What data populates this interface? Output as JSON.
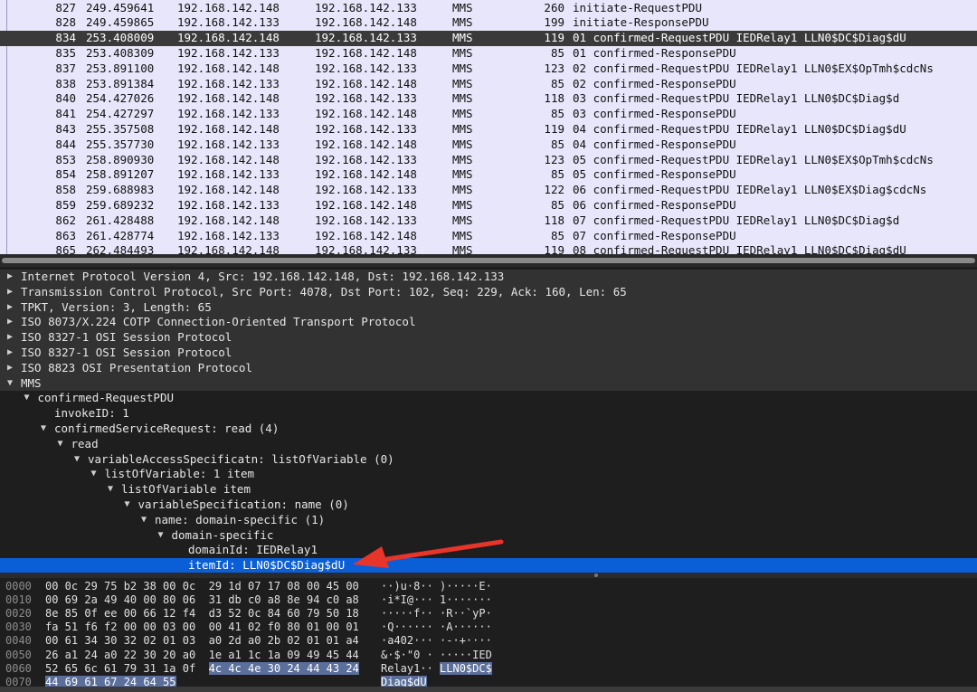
{
  "packets": [
    {
      "no": "827",
      "time": "249.459641",
      "src": "192.168.142.148",
      "dst": "192.168.142.133",
      "proto": "MMS",
      "len": "260",
      "info": "initiate-RequestPDU",
      "selected": false
    },
    {
      "no": "828",
      "time": "249.459865",
      "src": "192.168.142.133",
      "dst": "192.168.142.148",
      "proto": "MMS",
      "len": "199",
      "info": "initiate-ResponsePDU",
      "selected": false
    },
    {
      "no": "834",
      "time": "253.408009",
      "src": "192.168.142.148",
      "dst": "192.168.142.133",
      "proto": "MMS",
      "len": "119",
      "info": "01 confirmed-RequestPDU IEDRelay1 LLN0$DC$Diag$dU",
      "selected": true
    },
    {
      "no": "835",
      "time": "253.408309",
      "src": "192.168.142.133",
      "dst": "192.168.142.148",
      "proto": "MMS",
      "len": "85",
      "info": "01 confirmed-ResponsePDU",
      "selected": false
    },
    {
      "no": "837",
      "time": "253.891100",
      "src": "192.168.142.148",
      "dst": "192.168.142.133",
      "proto": "MMS",
      "len": "123",
      "info": "02 confirmed-RequestPDU IEDRelay1 LLN0$EX$OpTmh$cdcNs",
      "selected": false
    },
    {
      "no": "838",
      "time": "253.891384",
      "src": "192.168.142.133",
      "dst": "192.168.142.148",
      "proto": "MMS",
      "len": "85",
      "info": "02 confirmed-ResponsePDU",
      "selected": false
    },
    {
      "no": "840",
      "time": "254.427026",
      "src": "192.168.142.148",
      "dst": "192.168.142.133",
      "proto": "MMS",
      "len": "118",
      "info": "03 confirmed-RequestPDU IEDRelay1 LLN0$DC$Diag$d",
      "selected": false
    },
    {
      "no": "841",
      "time": "254.427297",
      "src": "192.168.142.133",
      "dst": "192.168.142.148",
      "proto": "MMS",
      "len": "85",
      "info": "03 confirmed-ResponsePDU",
      "selected": false
    },
    {
      "no": "843",
      "time": "255.357508",
      "src": "192.168.142.148",
      "dst": "192.168.142.133",
      "proto": "MMS",
      "len": "119",
      "info": "04 confirmed-RequestPDU IEDRelay1 LLN0$DC$Diag$dU",
      "selected": false
    },
    {
      "no": "844",
      "time": "255.357730",
      "src": "192.168.142.133",
      "dst": "192.168.142.148",
      "proto": "MMS",
      "len": "85",
      "info": "04 confirmed-ResponsePDU",
      "selected": false
    },
    {
      "no": "853",
      "time": "258.890930",
      "src": "192.168.142.148",
      "dst": "192.168.142.133",
      "proto": "MMS",
      "len": "123",
      "info": "05 confirmed-RequestPDU IEDRelay1 LLN0$EX$OpTmh$cdcNs",
      "selected": false
    },
    {
      "no": "854",
      "time": "258.891207",
      "src": "192.168.142.133",
      "dst": "192.168.142.148",
      "proto": "MMS",
      "len": "85",
      "info": "05 confirmed-ResponsePDU",
      "selected": false
    },
    {
      "no": "858",
      "time": "259.688983",
      "src": "192.168.142.148",
      "dst": "192.168.142.133",
      "proto": "MMS",
      "len": "122",
      "info": "06 confirmed-RequestPDU IEDRelay1 LLN0$EX$Diag$cdcNs",
      "selected": false
    },
    {
      "no": "859",
      "time": "259.689232",
      "src": "192.168.142.133",
      "dst": "192.168.142.148",
      "proto": "MMS",
      "len": "85",
      "info": "06 confirmed-ResponsePDU",
      "selected": false
    },
    {
      "no": "862",
      "time": "261.428488",
      "src": "192.168.142.148",
      "dst": "192.168.142.133",
      "proto": "MMS",
      "len": "118",
      "info": "07 confirmed-RequestPDU IEDRelay1 LLN0$DC$Diag$d",
      "selected": false
    },
    {
      "no": "863",
      "time": "261.428774",
      "src": "192.168.142.133",
      "dst": "192.168.142.148",
      "proto": "MMS",
      "len": "85",
      "info": "07 confirmed-ResponsePDU",
      "selected": false
    },
    {
      "no": "865",
      "time": "262.484493",
      "src": "192.168.142.148",
      "dst": "192.168.142.133",
      "proto": "MMS",
      "len": "119",
      "info": "08 confirmed-RequestPDU IEDRelay1 LLN0$DC$Diag$dU",
      "selected": false
    }
  ],
  "details": [
    {
      "text": "Internet Protocol Version 4, Src: 192.168.142.148, Dst: 192.168.142.133",
      "level": 0,
      "toggle": "collapsed",
      "style": "gray"
    },
    {
      "text": "Transmission Control Protocol, Src Port: 4078, Dst Port: 102, Seq: 229, Ack: 160, Len: 65",
      "level": 0,
      "toggle": "collapsed",
      "style": "gray"
    },
    {
      "text": "TPKT, Version: 3, Length: 65",
      "level": 0,
      "toggle": "collapsed",
      "style": "gray"
    },
    {
      "text": "ISO 8073/X.224 COTP Connection-Oriented Transport Protocol",
      "level": 0,
      "toggle": "collapsed",
      "style": "gray"
    },
    {
      "text": "ISO 8327-1 OSI Session Protocol",
      "level": 0,
      "toggle": "collapsed",
      "style": "gray"
    },
    {
      "text": "ISO 8327-1 OSI Session Protocol",
      "level": 0,
      "toggle": "collapsed",
      "style": "gray"
    },
    {
      "text": "ISO 8823 OSI Presentation Protocol",
      "level": 0,
      "toggle": "collapsed",
      "style": "gray"
    },
    {
      "text": "MMS",
      "level": 0,
      "toggle": "expanded",
      "style": "gray"
    },
    {
      "text": "confirmed-RequestPDU",
      "level": 1,
      "toggle": "expanded",
      "style": ""
    },
    {
      "text": "invokeID: 1",
      "level": 2,
      "toggle": "none",
      "style": ""
    },
    {
      "text": "confirmedServiceRequest: read (4)",
      "level": 2,
      "toggle": "expanded",
      "style": ""
    },
    {
      "text": "read",
      "level": 3,
      "toggle": "expanded",
      "style": ""
    },
    {
      "text": "variableAccessSpecificatn: listOfVariable (0)",
      "level": 4,
      "toggle": "expanded",
      "style": ""
    },
    {
      "text": "listOfVariable: 1 item",
      "level": 5,
      "toggle": "expanded",
      "style": ""
    },
    {
      "text": "listOfVariable item",
      "level": 6,
      "toggle": "expanded",
      "style": ""
    },
    {
      "text": "variableSpecification: name (0)",
      "level": 7,
      "toggle": "expanded",
      "style": ""
    },
    {
      "text": "name: domain-specific (1)",
      "level": 8,
      "toggle": "expanded",
      "style": ""
    },
    {
      "text": "domain-specific",
      "level": 9,
      "toggle": "expanded",
      "style": ""
    },
    {
      "text": "domainId: IEDRelay1",
      "level": 10,
      "toggle": "none",
      "style": ""
    },
    {
      "text": "itemId: LLN0$DC$Diag$dU",
      "level": 10,
      "toggle": "none",
      "style": "sel"
    }
  ],
  "bytes": [
    {
      "off": "0000",
      "hex": [
        {
          "t": "00 0c 29 75 b2 38 00 0c  29 1d 07 17 08 00 45 00",
          "h": false
        }
      ],
      "ascii": [
        {
          "t": "··)u·8·· )·····E·",
          "h": false
        }
      ]
    },
    {
      "off": "0010",
      "hex": [
        {
          "t": "00 69 2a 49 40 00 80 06  31 db c0 a8 8e 94 c0 a8",
          "h": false
        }
      ],
      "ascii": [
        {
          "t": "·i*I@··· 1·······",
          "h": false
        }
      ]
    },
    {
      "off": "0020",
      "hex": [
        {
          "t": "8e 85 0f ee 00 66 12 f4  d3 52 0c 84 60 79 50 18",
          "h": false
        }
      ],
      "ascii": [
        {
          "t": "·····f·· ·R··`yP·",
          "h": false
        }
      ]
    },
    {
      "off": "0030",
      "hex": [
        {
          "t": "fa 51 f6 f2 00 00 03 00  00 41 02 f0 80 01 00 01",
          "h": false
        }
      ],
      "ascii": [
        {
          "t": "·Q······ ·A······",
          "h": false
        }
      ]
    },
    {
      "off": "0040",
      "hex": [
        {
          "t": "00 61 34 30 32 02 01 03  a0 2d a0 2b 02 01 01 a4",
          "h": false
        }
      ],
      "ascii": [
        {
          "t": "·a402··· ·-·+····",
          "h": false
        }
      ]
    },
    {
      "off": "0050",
      "hex": [
        {
          "t": "26 a1 24 a0 22 30 20 a0  1e a1 1c 1a 09 49 45 44",
          "h": false
        }
      ],
      "ascii": [
        {
          "t": "&·$·\"0 · ·····IED",
          "h": false
        }
      ]
    },
    {
      "off": "0060",
      "hex": [
        {
          "t": "52 65 6c 61 79 31 1a 0f  ",
          "h": false
        },
        {
          "t": "4c 4c 4e 30 24 44 43 24",
          "h": true
        }
      ],
      "ascii": [
        {
          "t": "Relay1·· ",
          "h": false
        },
        {
          "t": "LLN0$DC$",
          "h": true
        }
      ]
    },
    {
      "off": "0070",
      "hex": [
        {
          "t": "44 69 61 67 24 64 55",
          "h": true
        }
      ],
      "ascii": [
        {
          "t": "Diag$dU",
          "h": true
        }
      ]
    }
  ],
  "colors": {
    "selected_blue": "#0a5fd6",
    "list_bg": "#e7e6fa",
    "arrow": "#e8352a",
    "byte_highlight": "#5a6f9a"
  }
}
